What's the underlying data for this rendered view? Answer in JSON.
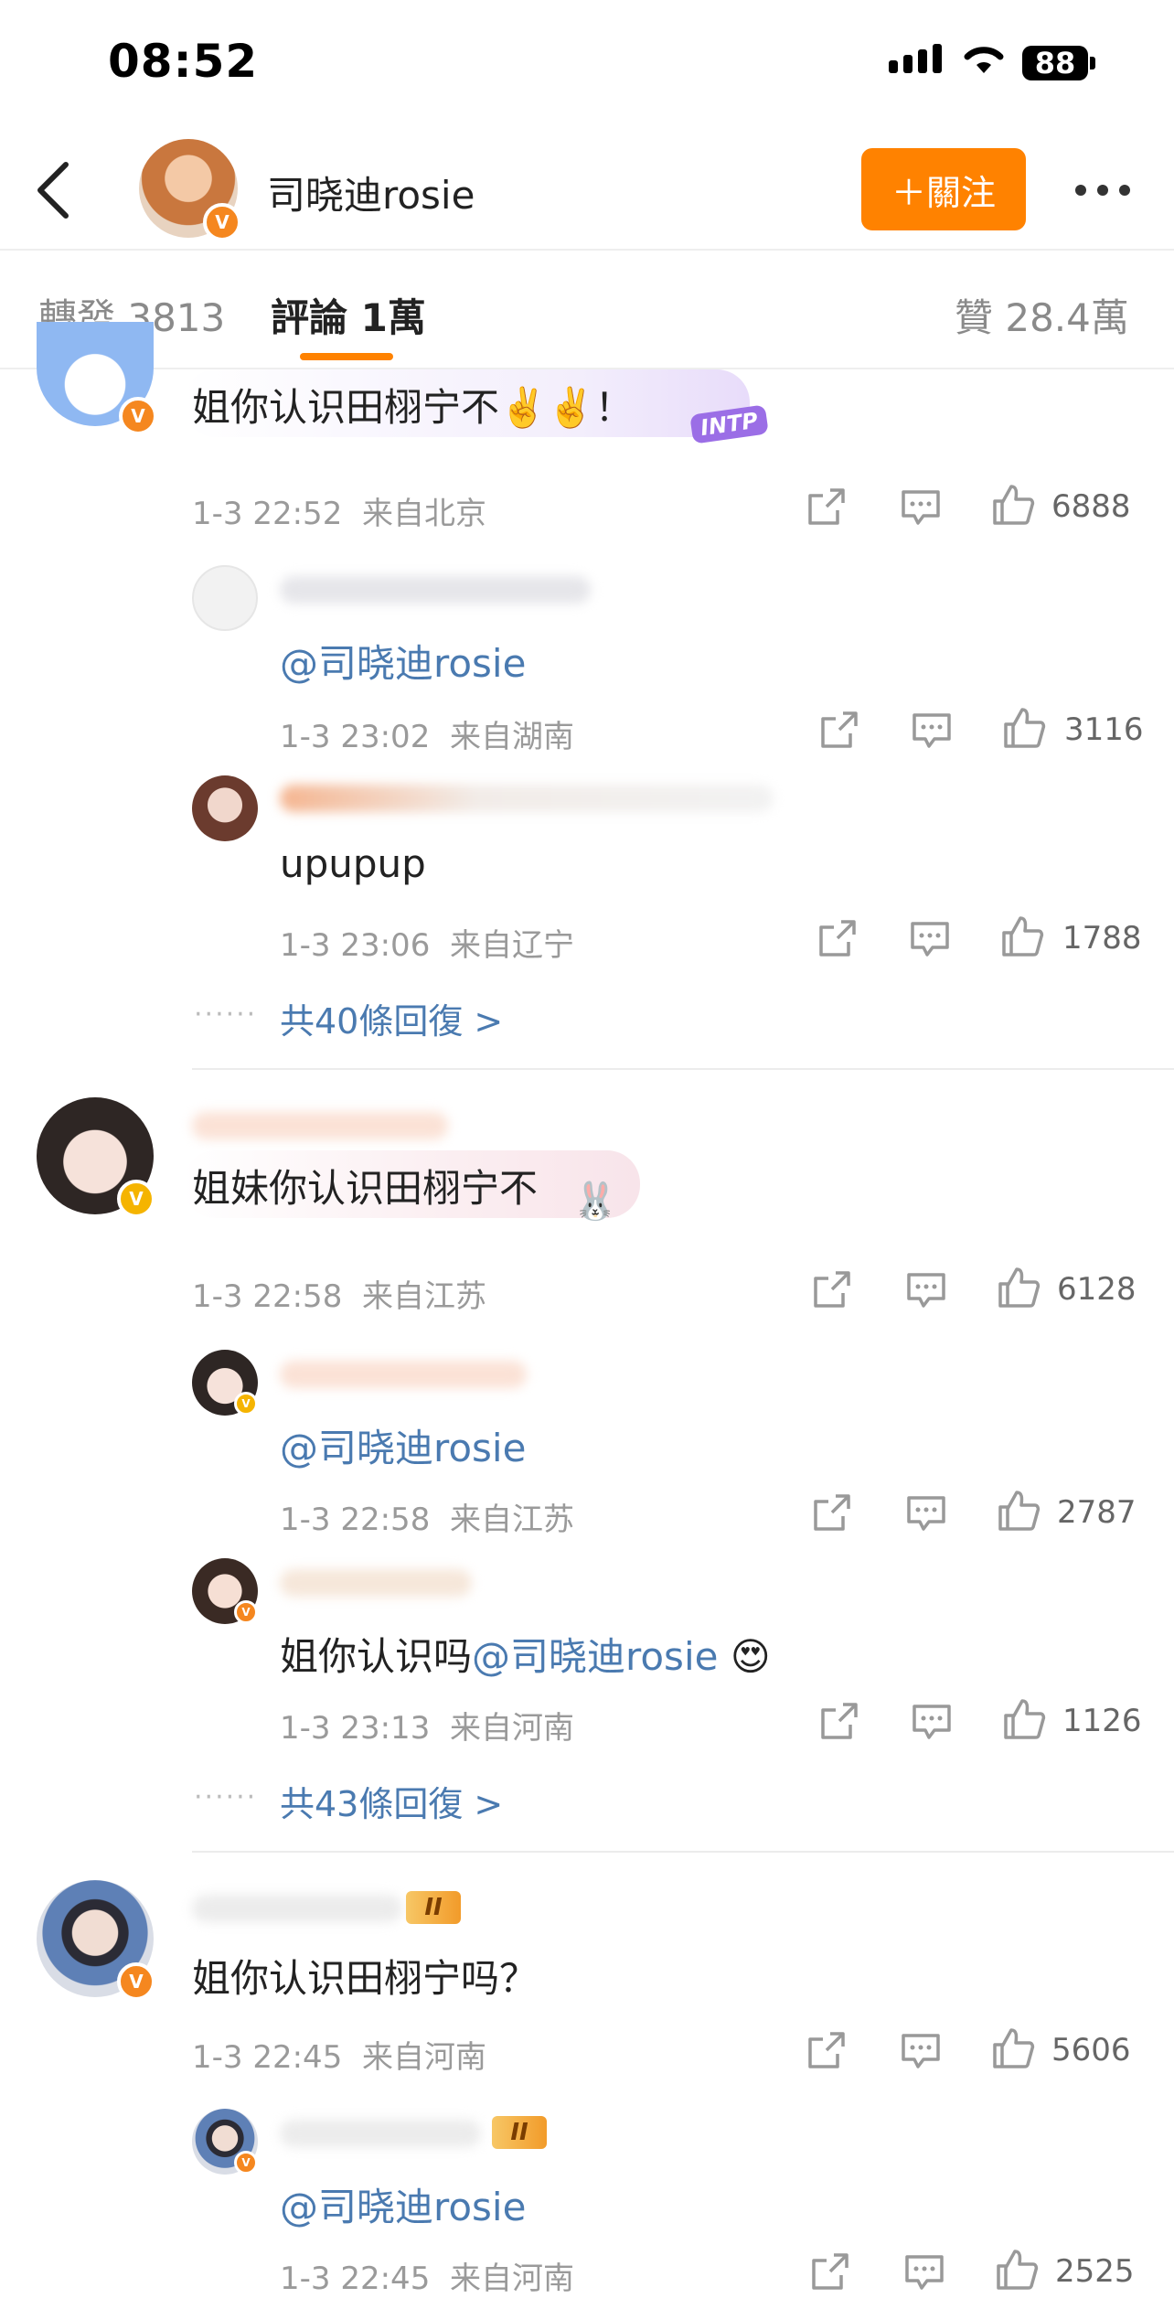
{
  "status": {
    "time": "08:52",
    "battery": "88"
  },
  "header": {
    "name": "司晓迪rosie",
    "follow_label": "＋關注"
  },
  "tabs": {
    "repost": "轉發 3813",
    "comments": "評論 1萬",
    "likes": "贊 28.4萬"
  },
  "comments": [
    {
      "text": "姐你认识田栩宁不✌️✌️！",
      "time": "1-3 22:52",
      "location": "来自北京",
      "likes": "6888",
      "replies": [
        {
          "text": "@司晓迪rosie",
          "time": "1-3 23:02",
          "location": "来自湖南",
          "likes": "3116"
        },
        {
          "text": "upupup",
          "time": "1-3 23:06",
          "location": "来自辽宁",
          "likes": "1788"
        }
      ],
      "more": "共40條回復 >"
    },
    {
      "text": "姐妹你认识田栩宁不",
      "time": "1-3 22:58",
      "location": "来自江苏",
      "likes": "6128",
      "replies": [
        {
          "text": "@司晓迪rosie",
          "time": "1-3 22:58",
          "location": "来自江苏",
          "likes": "2787"
        },
        {
          "text_prefix": "姐你认识吗",
          "text_at": "@司晓迪rosie",
          "text_emoji": "😍",
          "time": "1-3 23:13",
          "location": "来自河南",
          "likes": "1126"
        }
      ],
      "more": "共43條回復 >"
    },
    {
      "text": "姐你认识田栩宁吗？",
      "time": "1-3 22:45",
      "location": "来自河南",
      "likes": "5606",
      "replies": [
        {
          "text": "@司晓迪rosie",
          "time": "1-3 22:45",
          "location": "来自河南",
          "likes": "2525"
        }
      ]
    }
  ],
  "decorations": {
    "intp_tag": "INTP",
    "level_badge": "II"
  },
  "icons": [
    "back-icon",
    "more-icon",
    "share-icon",
    "comment-icon",
    "like-icon",
    "verified-icon",
    "wifi-icon",
    "signal-icon",
    "battery-icon"
  ]
}
